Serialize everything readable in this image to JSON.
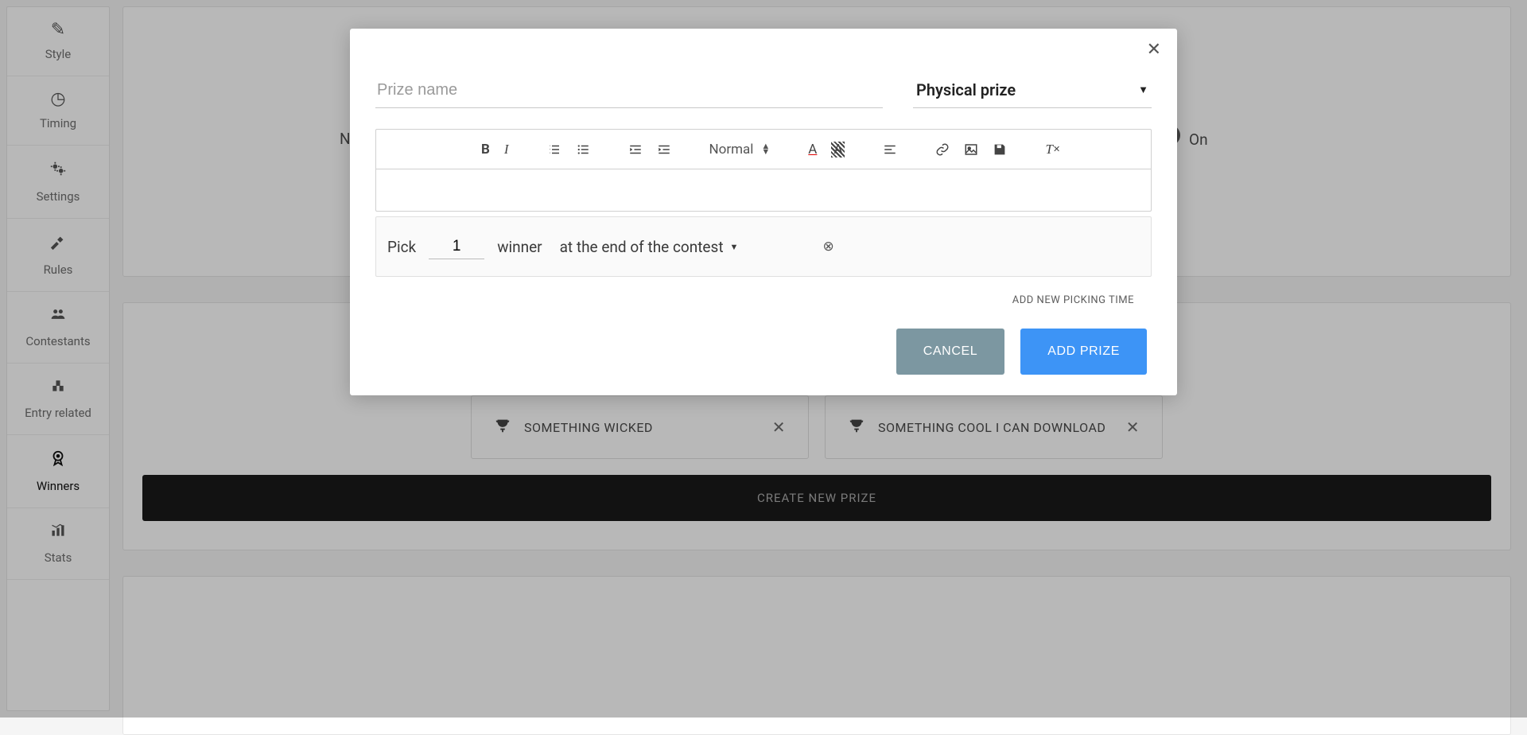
{
  "sidebar": {
    "items": [
      {
        "label": "Style",
        "icon": "✎"
      },
      {
        "label": "Timing",
        "icon": "◷"
      },
      {
        "label": "Settings",
        "icon": "⚙"
      },
      {
        "label": "Rules",
        "icon": "⚒"
      },
      {
        "label": "Contestants",
        "icon": "👥"
      },
      {
        "label": "Entry related",
        "icon": "▙"
      },
      {
        "label": "Winners",
        "icon": "🏅"
      },
      {
        "label": "Stats",
        "icon": "📊"
      }
    ]
  },
  "topcard": {
    "left_label_prefix": "N",
    "on_label": "On"
  },
  "prize_chips": [
    {
      "label": "SOMETHING WICKED"
    },
    {
      "label": "SOMETHING COOL I CAN DOWNLOAD"
    }
  ],
  "create_bar": "CREATE NEW PRIZE",
  "modal": {
    "prize_name_placeholder": "Prize name",
    "prize_type": "Physical prize",
    "toolbar_normal": "Normal",
    "pick_label": "Pick",
    "pick_count": "1",
    "winner_label": "winner",
    "when_label": "at the end of the contest",
    "add_new_picking": "ADD NEW PICKING TIME",
    "cancel_label": "CANCEL",
    "add_prize_label": "ADD PRIZE"
  }
}
